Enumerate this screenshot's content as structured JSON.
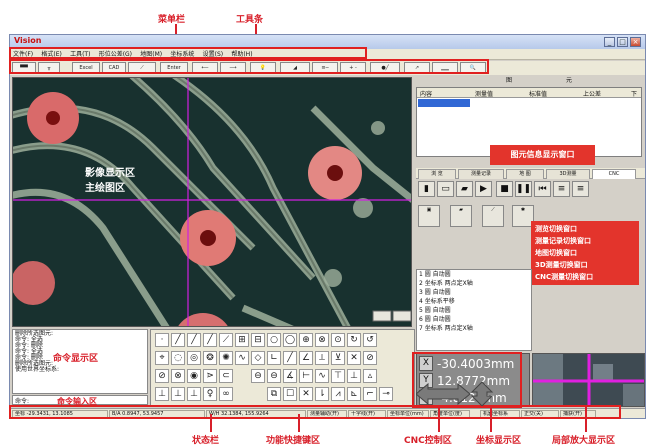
{
  "annotations": {
    "menubar_label": "菜单栏",
    "toolbar_label": "工具条",
    "image_area_line1": "影像显示区",
    "image_area_line2": "主绘图区",
    "element_info_window": "图元信息显示窗口",
    "command_display_area": "命令显示区",
    "command_input_area": "命令输入区",
    "switch_lines": [
      "测览切换窗口",
      "测量记录切换窗口",
      "地图切换窗口",
      "3D测量切换窗口",
      "CNC测量切换窗口"
    ],
    "bottom_labels": [
      "状态栏",
      "功能快捷键区",
      "CNC控制区",
      "坐标显示区",
      "局部放大显示区"
    ]
  },
  "window": {
    "title": "Vision",
    "controls": [
      "_",
      "□",
      "×"
    ],
    "menu": [
      "文件(F)",
      "格式(E)",
      "工具(T)",
      "形位公差(G)",
      "地图(M)",
      "坐标系统",
      "设置(S)",
      "帮助(H)"
    ],
    "toolbar": [
      "Excel",
      "CAD",
      "Enter",
      "+ -"
    ]
  },
  "right_panel": {
    "header": [
      "图",
      "元"
    ],
    "columns": [
      "内容",
      "测量值",
      "标准值",
      "上公差",
      "下"
    ],
    "tabs": [
      "浏 览",
      "测量记录",
      "地 图",
      "3D测量",
      "CNC"
    ],
    "shapes": [
      "1 圆   自动圆",
      "2 坐标系  两点定X轴",
      "3 圆   自动圆",
      "4 坐标系平移",
      "5 圆   自动圆",
      "6 圆   自动圆",
      "7 坐标系  两点定X轴"
    ]
  },
  "command_log": [
    "删除所选图元:",
    "命令: 全选",
    "命令: 删除",
    "命令: 全选",
    "命令: 删除",
    "删除所选图元:",
    "使用世界坐标系:"
  ],
  "command_prompt": "命令:",
  "coordinates": {
    "x_label": "X",
    "x_value": "-30.4003mm",
    "y_label": "Y",
    "y_value": "12.8772mm",
    "z_label": "Z",
    "z_value": "-4.8128mm"
  },
  "status": {
    "cursor": "坐标 -29.3431, 13.1085",
    "ba": "B/A 0.8947, 53.9457",
    "wh": "W/H 32.1384, 155.9264",
    "items": [
      "测量辅助(开)",
      "十字线(开)",
      "坐标单位(mm)",
      "角度单位(度)",
      "机器坐标系",
      "正交(关)",
      "捕获(开)"
    ]
  },
  "colors": {
    "accent": "#d8202a",
    "info_box": "#e3342c",
    "crosshair": "#d020e0",
    "selection": "#0a246a"
  }
}
